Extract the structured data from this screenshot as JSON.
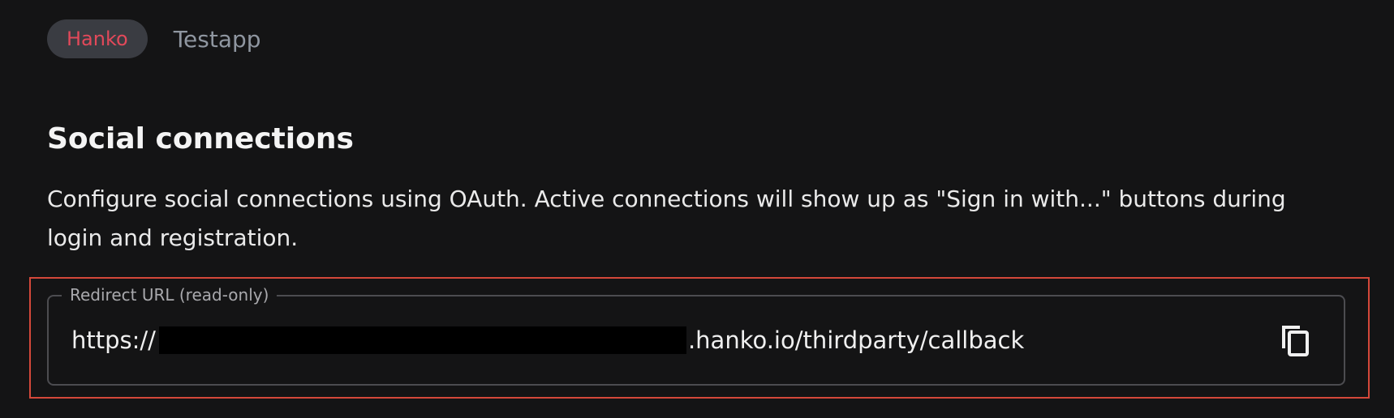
{
  "breadcrumb": {
    "organization": "Hanko",
    "project": "Testapp"
  },
  "section": {
    "title": "Social connections",
    "description": "Configure social connections using OAuth. Active connections will show up as \"Sign in with...\" buttons during login and registration."
  },
  "redirect_field": {
    "label": "Redirect URL (read-only)",
    "value_prefix": "https://",
    "value_suffix": ".hanko.io/thirdparty/callback",
    "copy_icon": "copy-icon"
  },
  "colors": {
    "background": "#141415",
    "accent": "#e2495a",
    "highlight_border": "#d4483a"
  }
}
